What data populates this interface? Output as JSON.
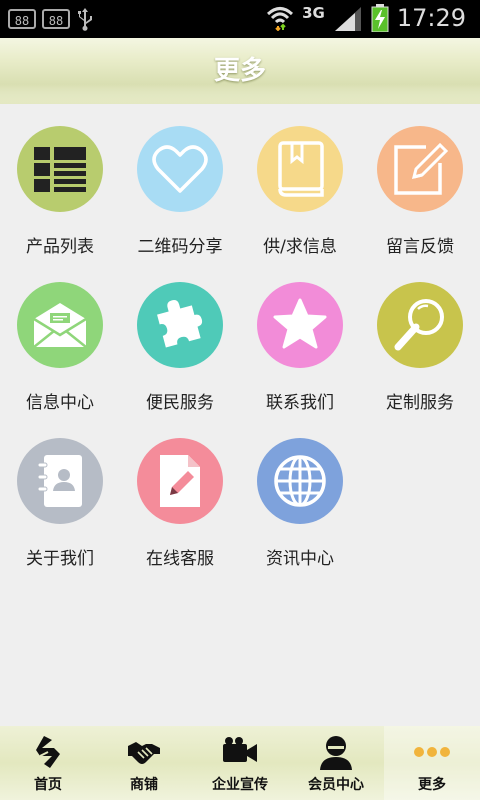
{
  "status_bar": {
    "left_box_1": "88",
    "left_box_2": "88",
    "network": "3G",
    "time": "17:29"
  },
  "header": {
    "title": "更多"
  },
  "grid": [
    {
      "label": "产品列表",
      "icon": "list-icon",
      "color": "#b8cc6e"
    },
    {
      "label": "二维码分享",
      "icon": "heart-icon",
      "color": "#a8dcf4"
    },
    {
      "label": "供/求信息",
      "icon": "book-icon",
      "color": "#f6d98a"
    },
    {
      "label": "留言反馈",
      "icon": "edit-icon",
      "color": "#f7b78a"
    },
    {
      "label": "信息中心",
      "icon": "mail-icon",
      "color": "#8fd67a"
    },
    {
      "label": "便民服务",
      "icon": "puzzle-icon",
      "color": "#4fcab8"
    },
    {
      "label": "联系我们",
      "icon": "star-icon",
      "color": "#f28cd8"
    },
    {
      "label": "定制服务",
      "icon": "magnifier-icon",
      "color": "#c8c44c"
    },
    {
      "label": "关于我们",
      "icon": "contact-book-icon",
      "color": "#b6bcc6"
    },
    {
      "label": "在线客服",
      "icon": "document-pen-icon",
      "color": "#f48c9a"
    },
    {
      "label": "资讯中心",
      "icon": "globe-icon",
      "color": "#7ea2dc"
    }
  ],
  "tabs": [
    {
      "label": "首页",
      "icon": "home-logo-icon"
    },
    {
      "label": "商铺",
      "icon": "handshake-icon"
    },
    {
      "label": "企业宣传",
      "icon": "video-camera-icon"
    },
    {
      "label": "会员中心",
      "icon": "user-icon"
    },
    {
      "label": "更多",
      "icon": "more-dots-icon",
      "active": true
    }
  ]
}
